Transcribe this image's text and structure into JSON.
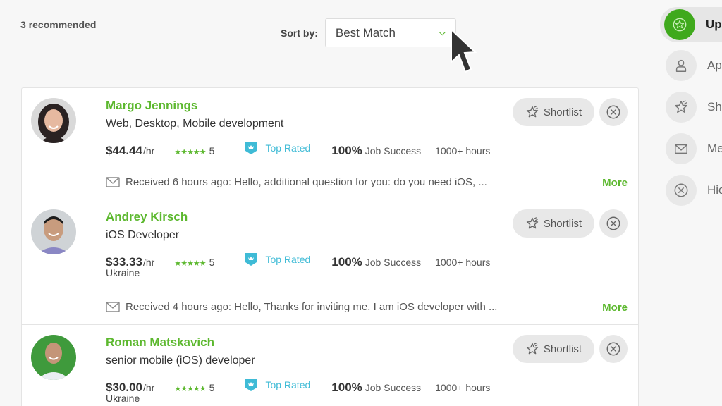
{
  "header": {
    "recommended_count": "3 recommended",
    "sort_label": "Sort by:",
    "sort_value": "Best Match"
  },
  "colors": {
    "brand_green": "#5cb82e",
    "top_rated_blue": "#3fbbd6",
    "active_nav_green": "#3fa91c"
  },
  "sidebar": {
    "items": [
      {
        "label": "Up",
        "icon": "star-badge-icon",
        "active": true
      },
      {
        "label": "Ap",
        "icon": "person-icon",
        "active": false
      },
      {
        "label": "Sh",
        "icon": "shortlist-star-icon",
        "active": false
      },
      {
        "label": "Me",
        "icon": "mail-icon",
        "active": false
      },
      {
        "label": "Hic",
        "icon": "close-circle-icon",
        "active": false
      }
    ]
  },
  "freelancers": [
    {
      "name": "Margo Jennings",
      "title": "Web, Desktop, Mobile development",
      "rate": "$44.44",
      "rate_unit": "/hr",
      "stars": "★★★★★",
      "rating": "5",
      "badge": "Top Rated",
      "job_success_pct": "100%",
      "job_success_label": "Job Success",
      "hours": "1000+ hours",
      "location": "",
      "message": "Received 6 hours ago: Hello, additional question for you: do you need iOS, ...",
      "more_label": "More",
      "shortlist_label": "Shortlist"
    },
    {
      "name": "Andrey Kirsch",
      "title": "iOS Developer",
      "rate": "$33.33",
      "rate_unit": "/hr",
      "stars": "★★★★★",
      "rating": "5",
      "badge": "Top Rated",
      "job_success_pct": "100%",
      "job_success_label": "Job Success",
      "hours": "1000+ hours",
      "location": "Ukraine",
      "message": "Received 4 hours ago: Hello, Thanks for inviting me. I am iOS developer with ...",
      "more_label": "More",
      "shortlist_label": "Shortlist"
    },
    {
      "name": "Roman Matskavich",
      "title": "senior mobile (iOS) developer",
      "rate": "$30.00",
      "rate_unit": "/hr",
      "stars": "★★★★★",
      "rating": "5",
      "badge": "Top Rated",
      "job_success_pct": "100%",
      "job_success_label": "Job Success",
      "hours": "1000+ hours",
      "location": "Ukraine",
      "shortlist_label": "Shortlist"
    }
  ]
}
